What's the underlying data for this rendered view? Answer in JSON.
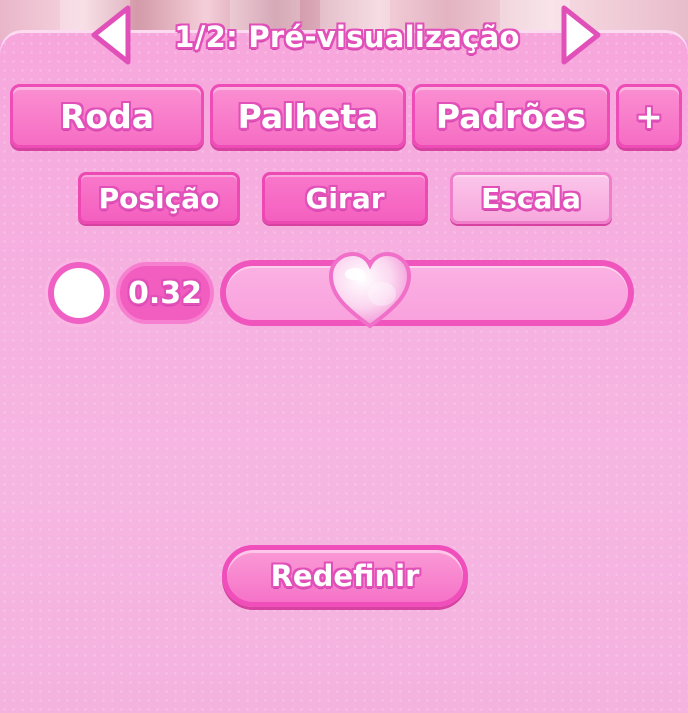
{
  "header": {
    "title": "1/2: Pré-visualização",
    "prev_icon": "triangle-left-icon",
    "next_icon": "triangle-right-icon"
  },
  "tabs": [
    {
      "label": "Roda"
    },
    {
      "label": "Palheta"
    },
    {
      "label": "Padrões"
    },
    {
      "label": "+"
    }
  ],
  "transform_modes": [
    {
      "label": "Posição",
      "active": false
    },
    {
      "label": "Girar",
      "active": false
    },
    {
      "label": "Escala",
      "active": true
    }
  ],
  "slider": {
    "value_label": "0.32",
    "value": 0.32,
    "swatch_color": "#ffffff",
    "thumb_icon": "heart-icon"
  },
  "reset": {
    "label": "Redefinir"
  },
  "colors": {
    "panel": "#f6b0e0",
    "button": "#f66dc4",
    "outline": "#e150b8"
  }
}
